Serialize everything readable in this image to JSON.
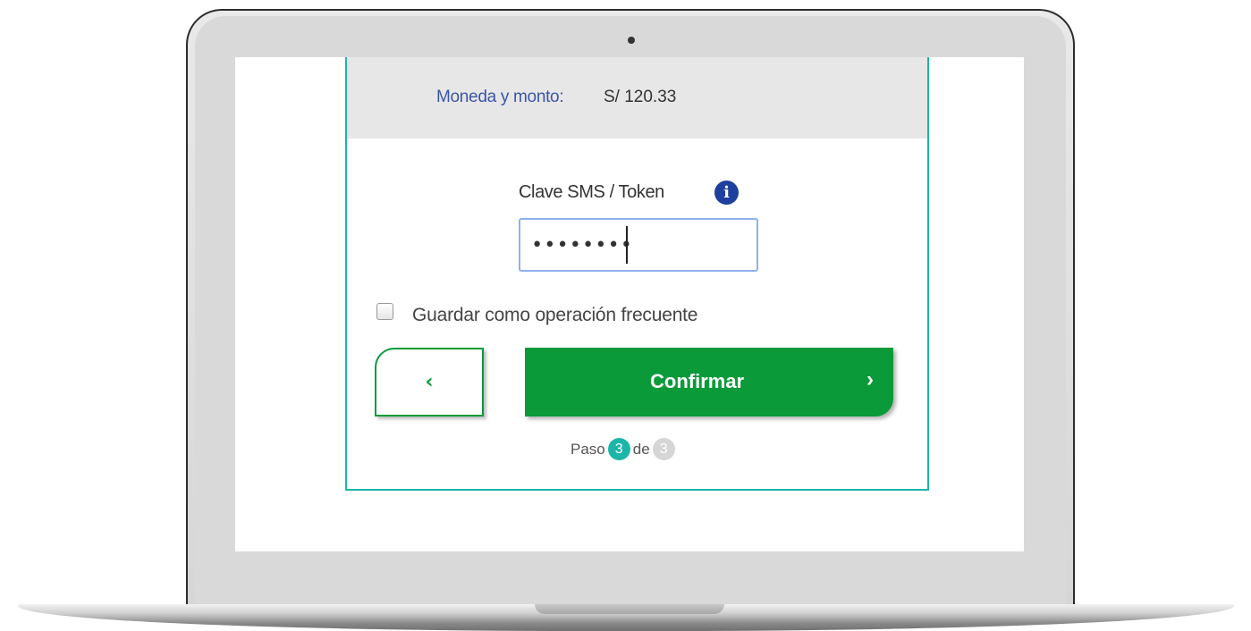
{
  "summary": {
    "amount_label": "Moneda y monto:",
    "amount_value": "S/ 120.33"
  },
  "token": {
    "label": "Clave SMS / Token",
    "value": "••••••••",
    "info_icon": "info-icon"
  },
  "options": {
    "save_frequent_label": "Guardar como operación frecuente",
    "save_frequent_checked": false
  },
  "actions": {
    "back_glyph": "‹",
    "confirm_label": "Confirmar",
    "confirm_glyph": "›"
  },
  "steps": {
    "prefix": "Paso",
    "current": "3",
    "separator": "de",
    "total": "3"
  },
  "colors": {
    "primary_green": "#0a9a3a",
    "accent_teal": "#1cb6a8",
    "info_blue": "#1f3f9f",
    "label_blue": "#3c55a8"
  }
}
